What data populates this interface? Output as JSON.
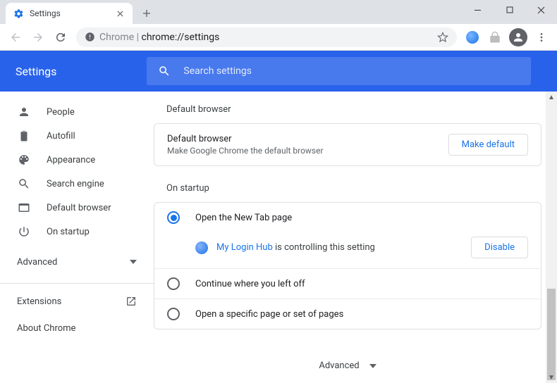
{
  "window": {
    "tab_title": "Settings"
  },
  "toolbar": {
    "url_prefix": "Chrome",
    "url_path": "chrome://settings"
  },
  "header": {
    "title": "Settings",
    "search_placeholder": "Search settings"
  },
  "sidebar": {
    "items": [
      {
        "label": "People"
      },
      {
        "label": "Autofill"
      },
      {
        "label": "Appearance"
      },
      {
        "label": "Search engine"
      },
      {
        "label": "Default browser"
      },
      {
        "label": "On startup"
      }
    ],
    "advanced": "Advanced",
    "extensions": "Extensions",
    "about": "About Chrome"
  },
  "sections": {
    "default_browser": {
      "title": "Default browser",
      "row_title": "Default browser",
      "row_subtitle": "Make Google Chrome the default browser",
      "button": "Make default"
    },
    "on_startup": {
      "title": "On startup",
      "options": [
        "Open the New Tab page",
        "Continue where you left off",
        "Open a specific page or set of pages"
      ],
      "controlling_ext": "My Login Hub",
      "controlling_suffix": " is controlling this setting",
      "disable": "Disable"
    },
    "footer_advanced": "Advanced"
  }
}
